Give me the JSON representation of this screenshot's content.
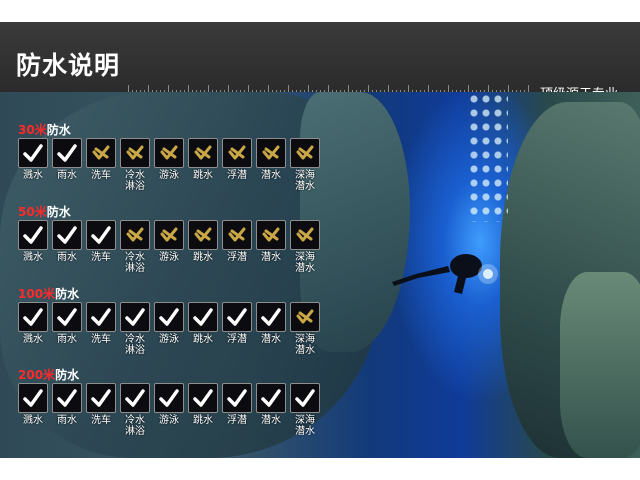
{
  "header": {
    "title": "防水说明",
    "tagline": "顶级源于专业"
  },
  "activities": [
    "溅水",
    "雨水",
    "洗车",
    "冷水\n淋浴",
    "游泳",
    "跳水",
    "浮潜",
    "潜水",
    "深海\n潜水"
  ],
  "sections": [
    {
      "depth": "30米",
      "label": "防水",
      "status": [
        true,
        true,
        false,
        false,
        false,
        false,
        false,
        false,
        false
      ]
    },
    {
      "depth": "50米",
      "label": "防水",
      "status": [
        true,
        true,
        true,
        false,
        false,
        false,
        false,
        false,
        false
      ]
    },
    {
      "depth": "100米",
      "label": "防水",
      "status": [
        true,
        true,
        true,
        true,
        true,
        true,
        true,
        true,
        false
      ]
    },
    {
      "depth": "200米",
      "label": "防水",
      "status": [
        true,
        true,
        true,
        true,
        true,
        true,
        true,
        true,
        true
      ]
    }
  ],
  "icons": {
    "supported": "check-icon",
    "unsupported": "check-crossed-icon"
  },
  "colors": {
    "header_bg": "#2b2b2b",
    "depth_number": "#ff2a2a",
    "supported_mark": "#ffffff",
    "unsupported_mark": "#c9a646"
  }
}
